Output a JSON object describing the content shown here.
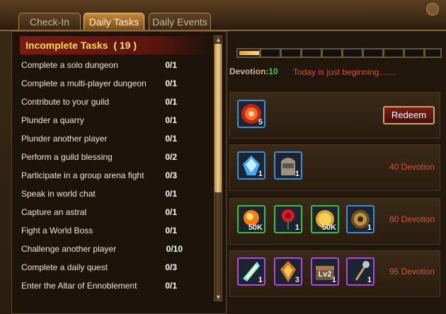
{
  "tabs": [
    {
      "label": "Check-In",
      "active": false
    },
    {
      "label": "Daily Tasks",
      "active": true
    },
    {
      "label": "Daily Events",
      "active": false
    }
  ],
  "tasks_header": {
    "title": "Incomplete Tasks",
    "count": "( 19 )"
  },
  "tasks": [
    {
      "name": "Complete a solo dungeon",
      "progress": "0/1"
    },
    {
      "name": "Complete a multi-player dungeon",
      "progress": "0/1"
    },
    {
      "name": "Contribute to your guild",
      "progress": "0/1"
    },
    {
      "name": "Plunder a quarry",
      "progress": "0/1"
    },
    {
      "name": "Plunder another player",
      "progress": "0/1"
    },
    {
      "name": "Perform a guild blessing",
      "progress": "0/2"
    },
    {
      "name": "Participate in a group arena fight",
      "progress": "0/3"
    },
    {
      "name": "Speak in world chat",
      "progress": "0/1"
    },
    {
      "name": "Capture an astral",
      "progress": "0/1"
    },
    {
      "name": "Fight a World Boss",
      "progress": "0/1"
    },
    {
      "name": "Challenge another player",
      "progress": "0/10"
    },
    {
      "name": "Complete a daily quest",
      "progress": "0/3"
    },
    {
      "name": "Enter the Altar of Ennoblement",
      "progress": "0/1"
    }
  ],
  "devotion": {
    "label": "Devotion:",
    "value": "10",
    "message": "Today is just beginning.......",
    "progress_fraction": 0.1
  },
  "reward_rows": [
    {
      "label": "",
      "button": "Redeem",
      "items": [
        {
          "icon": "red-orb-icon",
          "qty": "5",
          "rarity": "blue"
        }
      ]
    },
    {
      "label": "40 Devotion",
      "items": [
        {
          "icon": "blue-crystal-icon",
          "qty": "1",
          "rarity": "blue"
        },
        {
          "icon": "exp-tombstone-icon",
          "qty": "1",
          "rarity": "blue"
        }
      ]
    },
    {
      "label": "80 Devotion",
      "items": [
        {
          "icon": "fire-orb-icon",
          "qty": "50K",
          "rarity": "green"
        },
        {
          "icon": "rose-icon",
          "qty": "1",
          "rarity": "green"
        },
        {
          "icon": "gold-coin-icon",
          "qty": "50K",
          "rarity": "green"
        },
        {
          "icon": "bronze-coin-icon",
          "qty": "1",
          "rarity": "blue"
        }
      ]
    },
    {
      "label": "95 Devotion",
      "items": [
        {
          "icon": "rainbow-crystal-icon",
          "qty": "1",
          "rarity": "purple"
        },
        {
          "icon": "amber-crystal-icon",
          "qty": "3",
          "rarity": "purple"
        },
        {
          "icon": "lv2-chest-icon",
          "qty": "1",
          "rarity": "purple",
          "badge": "Lv2"
        },
        {
          "icon": "scepter-icon",
          "qty": "1",
          "rarity": "purple"
        }
      ]
    }
  ]
}
